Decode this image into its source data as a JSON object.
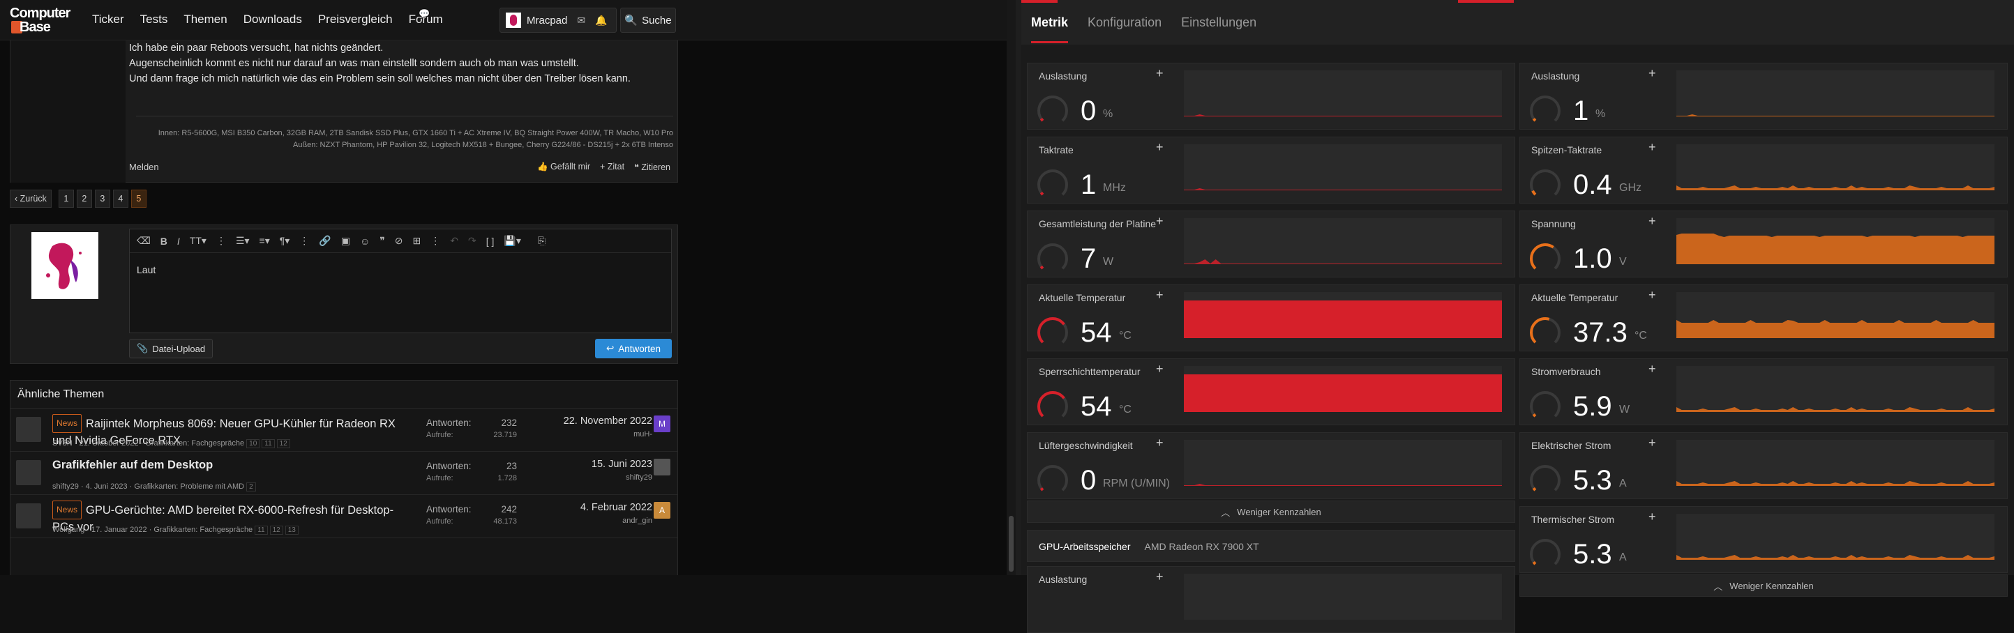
{
  "site": {
    "logo_line1": "Computer",
    "logo_line2": "Base",
    "nav": [
      "Ticker",
      "Tests",
      "Themen",
      "Downloads",
      "Preisvergleich",
      "Forum"
    ],
    "user": "Mracpad",
    "search": "Suche"
  },
  "post": {
    "lines": [
      "Ich habe ein paar Reboots versucht, hat nichts geändert.",
      "Augenscheinlich kommt es nicht nur darauf an was man einstellt sondern auch ob man was umstellt.",
      "Und dann frage ich mich natürlich wie das ein Problem sein soll welches man nicht über den Treiber lösen kann."
    ],
    "signature_line1": "Innen: R5-5600G, MSI B350 Carbon, 32GB RAM, 2TB Sandisk SSD Plus, GTX 1660 Ti + AC Xtreme IV, BQ Straight Power 400W, TR Macho, W10 Pro",
    "signature_line2": "Außen: NZXT Phantom, HP Pavilion 32, Logitech MX518 + Bungee, Cherry G224/86 - DS215j + 2x 6TB Intenso",
    "report": "Melden",
    "like": "Gefällt mir",
    "quote": "+ Zitat",
    "multiquote": "Zitieren"
  },
  "pagination": {
    "back": "‹ Zurück",
    "pages": [
      "1",
      "2",
      "3",
      "4",
      "5"
    ],
    "active": "5"
  },
  "reply": {
    "content": "Laut",
    "upload": "Datei-Upload",
    "submit": "Antworten"
  },
  "similar": {
    "heading": "Ähnliche Themen",
    "label_replies": "Antworten:",
    "label_views": "Aufrufe:",
    "rows": [
      {
        "badge": "News",
        "title": "Raijintek Morpheus 8069: Neuer GPU-Kühler für Radeon RX und Nvidia GeForce RTX",
        "meta": "SV3N · 21. Oktober 2022 · Grafikkarten: Fachgespräche",
        "pages": [
          "10",
          "11",
          "12"
        ],
        "replies": "232",
        "views": "23.719",
        "date": "22. November 2022",
        "user": "muH-",
        "avatar": "M",
        "avatar_color": "#6a3fc9",
        "bold": false
      },
      {
        "badge": "",
        "title": "Grafikfehler auf dem Desktop",
        "meta": "shifty29 · 4. Juni 2023 · Grafikkarten: Probleme mit AMD",
        "pages": [
          "2"
        ],
        "replies": "23",
        "views": "1.728",
        "date": "15. Juni 2023",
        "user": "shifty29",
        "avatar": "",
        "avatar_color": "#555555",
        "bold": true
      },
      {
        "badge": "News",
        "title": "GPU-Gerüchte: AMD bereitet RX-6000-Refresh für Desktop-PCs vor",
        "meta": "Wolfgang · 17. Januar 2022 · Grafikkarten: Fachgespräche",
        "pages": [
          "11",
          "12",
          "13"
        ],
        "replies": "242",
        "views": "48.173",
        "date": "4. Februar 2022",
        "user": "andr_gin",
        "avatar": "A",
        "avatar_color": "#c98a3a",
        "bold": false
      }
    ]
  },
  "adrenalin": {
    "tabs": [
      "Metrik",
      "Konfiguration",
      "Einstellungen"
    ],
    "left_metrics": [
      {
        "name": "Auslastung",
        "value": "0",
        "unit": "%",
        "level": 0.0,
        "color": "#d6202a",
        "style": "line"
      },
      {
        "name": "Taktrate",
        "value": "1",
        "unit": "MHz",
        "level": 0.0,
        "color": "#d6202a",
        "style": "line"
      },
      {
        "name": "Gesamtleistung der Platine",
        "value": "7",
        "unit": "W",
        "level": 0.03,
        "color": "#d6202a",
        "style": "line"
      },
      {
        "name": "Aktuelle Temperatur",
        "value": "54",
        "unit": "°C",
        "level": 0.5,
        "color": "#d6202a",
        "style": "full"
      },
      {
        "name": "Sperrschichttemperatur",
        "value": "54",
        "unit": "°C",
        "level": 0.5,
        "color": "#d6202a",
        "style": "full"
      },
      {
        "name": "Lüftergeschwindigkeit",
        "value": "0",
        "unit": "RPM (U/MIN)",
        "level": 0.0,
        "color": "#d6202a",
        "style": "line"
      }
    ],
    "right_metrics": [
      {
        "name": "Auslastung",
        "value": "1",
        "unit": "%",
        "level": 0.0,
        "color": "#e8701a",
        "style": "line"
      },
      {
        "name": "Spitzen-Taktrate",
        "value": "0.4",
        "unit": "GHz",
        "level": 0.05,
        "color": "#e8701a",
        "style": "low"
      },
      {
        "name": "Spannung",
        "value": "1.0",
        "unit": "V",
        "level": 0.45,
        "color": "#e8701a",
        "style": "high"
      },
      {
        "name": "Aktuelle Temperatur",
        "value": "37.3",
        "unit": "°C",
        "level": 0.4,
        "color": "#e8701a",
        "style": "mid"
      },
      {
        "name": "Stromverbrauch",
        "value": "5.9",
        "unit": "W",
        "level": 0.03,
        "color": "#e8701a",
        "style": "low"
      },
      {
        "name": "Elektrischer Strom",
        "value": "5.3",
        "unit": "A",
        "level": 0.03,
        "color": "#e8701a",
        "style": "low"
      },
      {
        "name": "Thermischer Strom",
        "value": "5.3",
        "unit": "A",
        "level": 0.03,
        "color": "#e8701a",
        "style": "low"
      }
    ],
    "collapse_label": "Weniger Kennzahlen",
    "section_title": "GPU-Arbeitsspeicher",
    "section_sub": "AMD Radeon RX 7900 XT",
    "section_first_metric": "Auslastung"
  }
}
